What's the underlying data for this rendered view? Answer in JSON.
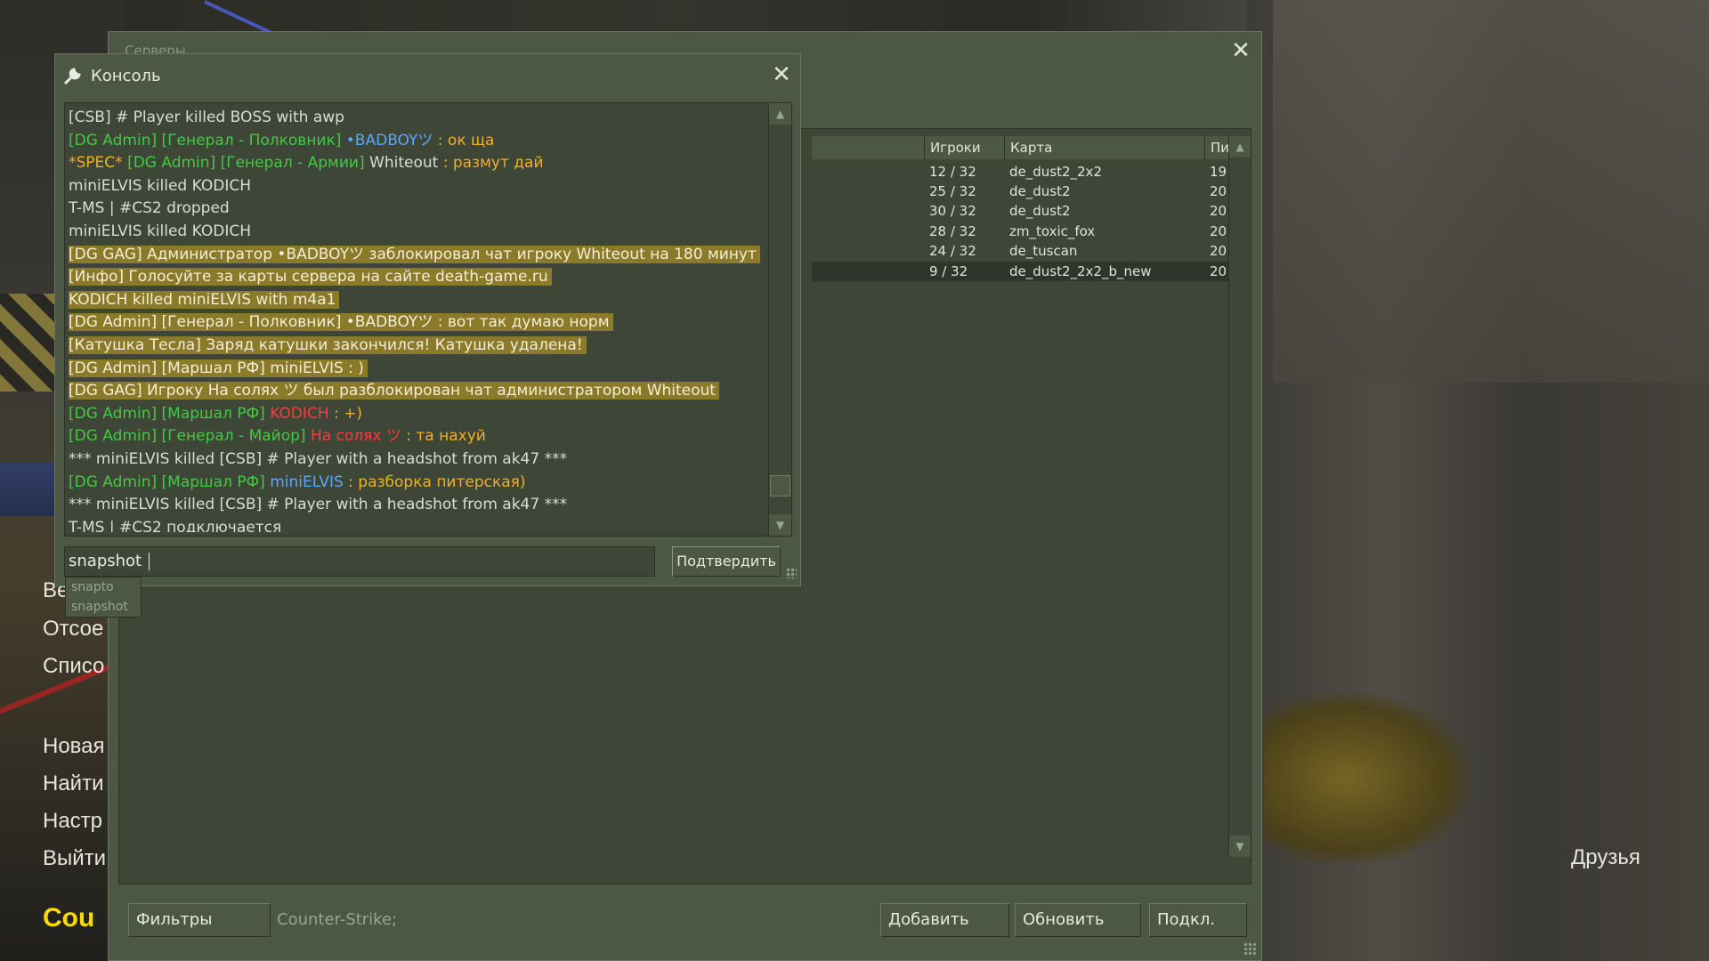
{
  "background": {
    "menu_items": [
      "Ве",
      "Отсое",
      "Списо",
      "Новая",
      "Найти",
      "Настр",
      "Выйти"
    ],
    "logo_text": "Cou",
    "friends_label": "Друзья"
  },
  "server_browser": {
    "title": "Серверы",
    "close_icon": "close-icon",
    "columns": {
      "players": "Игроки",
      "map": "Карта",
      "ping": "Пинг"
    },
    "rows": [
      {
        "players": "12 / 32",
        "map": "de_dust2_2x2",
        "ping": "19"
      },
      {
        "players": "25 / 32",
        "map": "de_dust2",
        "ping": "20"
      },
      {
        "players": "30 / 32",
        "map": "de_dust2",
        "ping": "20"
      },
      {
        "players": "28 / 32",
        "map": "zm_toxic_fox",
        "ping": "20"
      },
      {
        "players": "24 / 32",
        "map": "de_tuscan",
        "ping": "20"
      },
      {
        "players": "9 / 32",
        "map": "de_dust2_2x2_b_new",
        "ping": "20"
      }
    ],
    "filters_button": "Фильтры",
    "filter_text": "Counter-Strike;",
    "add_button": "Добавить",
    "refresh_button": "Обновить",
    "connect_button": "Подкл."
  },
  "console": {
    "title": "Консоль",
    "lines": [
      {
        "parts": [
          {
            "t": "[CSB] # Player killed BOSS with awp",
            "c": "white"
          }
        ]
      },
      {
        "parts": [
          {
            "t": "[DG Admin] [Генерал - Полковник] ",
            "c": "green"
          },
          {
            "t": "•BADBOYツ",
            "c": "blue"
          },
          {
            "t": " : ок ща",
            "c": "org"
          }
        ]
      },
      {
        "parts": [
          {
            "t": "*SPEC* ",
            "c": "org"
          },
          {
            "t": "[DG Admin] [Генерал - Армии] ",
            "c": "green"
          },
          {
            "t": "Whiteout",
            "c": "white"
          },
          {
            "t": " : размут дай",
            "c": "org"
          }
        ]
      },
      {
        "parts": [
          {
            "t": "miniELVIS killed KODICH",
            "c": "white"
          }
        ]
      },
      {
        "parts": [
          {
            "t": "T-MS | #CS2 dropped",
            "c": "white"
          }
        ]
      },
      {
        "parts": [
          {
            "t": "miniELVIS killed KODICH",
            "c": "white"
          }
        ]
      },
      {
        "highlight": true,
        "parts": [
          {
            "t": "[DG GAG] Администратор •BADBOYツ заблокировал чат игроку Whiteout на 180 минут",
            "c": "white"
          }
        ]
      },
      {
        "highlight": true,
        "parts": [
          {
            "t": "[Инфо] Голосуйте за карты сервера на сайте death-game.ru",
            "c": "white"
          }
        ]
      },
      {
        "highlight": true,
        "parts": [
          {
            "t": "KODICH killed miniELVIS with m4a1",
            "c": "white"
          }
        ]
      },
      {
        "highlight": true,
        "parts": [
          {
            "t": "[DG Admin] [Генерал - Полковник] •BADBOYツ : вот так думаю норм",
            "c": "white"
          }
        ]
      },
      {
        "highlight": true,
        "parts": [
          {
            "t": "[Катушка Тесла] Заряд катушки закончился! Катушка удалена!",
            "c": "white"
          }
        ]
      },
      {
        "highlight": true,
        "parts": [
          {
            "t": "[DG Admin] [Маршал РФ] miniELVIS : )",
            "c": "white"
          }
        ]
      },
      {
        "highlight": true,
        "parts": [
          {
            "t": "[DG GAG] Игроку На солях ツ был разблокирован чат администратором Whiteout",
            "c": "white"
          }
        ]
      },
      {
        "parts": [
          {
            "t": "[DG Admin] [Маршал РФ] ",
            "c": "green"
          },
          {
            "t": "KODICH",
            "c": "red"
          },
          {
            "t": " : +)",
            "c": "org"
          }
        ]
      },
      {
        "parts": [
          {
            "t": "[DG Admin] [Генерал - Майор] ",
            "c": "green"
          },
          {
            "t": "На солях ツ",
            "c": "red"
          },
          {
            "t": " : та нахуй",
            "c": "org"
          }
        ]
      },
      {
        "parts": [
          {
            "t": "*** miniELVIS killed [CSB] # Player with a headshot from ak47 ***",
            "c": "white"
          }
        ]
      },
      {
        "parts": [
          {
            "t": "[DG Admin] [Маршал РФ] ",
            "c": "green"
          },
          {
            "t": "miniELVIS",
            "c": "blue"
          },
          {
            "t": " : разборка питерская)",
            "c": "org"
          }
        ]
      },
      {
        "parts": [
          {
            "t": "*** miniELVIS killed [CSB] # Player with a headshot from ak47 ***",
            "c": "white"
          }
        ]
      },
      {
        "parts": [
          {
            "t": "T-MS | #CS2 подключается",
            "c": "white"
          }
        ]
      }
    ],
    "input_value": "snapshot ",
    "submit_button": "Подтвердить",
    "suggestions": [
      "snapto",
      "snapshot"
    ]
  },
  "colors": {
    "panel": "#4c5844",
    "panel_dark": "#3e4637",
    "highlight": "#8a7a2a",
    "green": "#43c943",
    "orange": "#f0b020",
    "red": "#ff3a3a",
    "blue": "#5aa7ff"
  }
}
